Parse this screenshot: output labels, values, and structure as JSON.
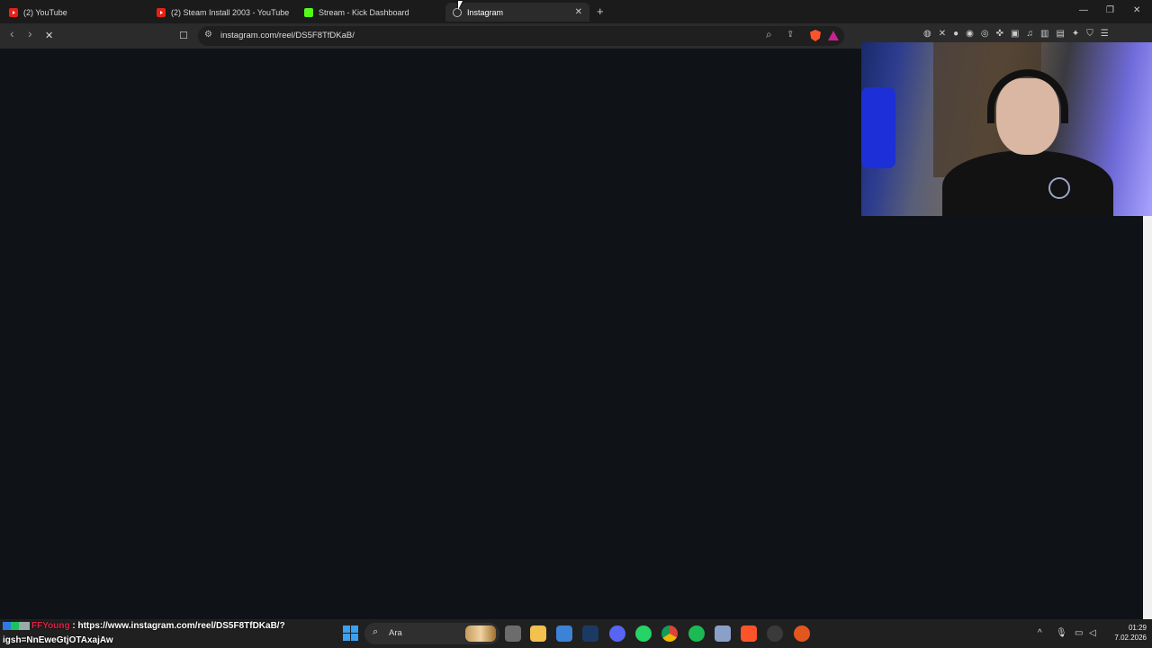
{
  "tabs": [
    {
      "label": "(2) YouTube",
      "icon": "youtube-icon"
    },
    {
      "label": "(2) Steam Install 2003 - YouTube",
      "icon": "youtube-icon"
    },
    {
      "label": "Stream - Kick Dashboard",
      "icon": "kick-icon"
    },
    {
      "label": "Instagram",
      "icon": "instagram-icon",
      "active": true
    }
  ],
  "tab_close": "✕",
  "new_tab": "+",
  "window_controls": {
    "minimize": "—",
    "maximize": "❐",
    "close": "✕"
  },
  "toolbar": {
    "back": "‹",
    "forward": "›",
    "stop": "✕",
    "bookmark": "☐",
    "url": "instagram.com/reel/DS5F8TfDKaB/",
    "site_info": "⚙",
    "zoom": "⌕",
    "share": "⇪"
  },
  "chat": {
    "username": "FFYoung",
    "separator": " : ",
    "message_line1": "https://www.instagram.com/reel/DS5F8TfDKaB/?",
    "message_line2": "igsh=NnEweGtjOTAxajAw"
  },
  "taskbar": {
    "search_label": "Ara",
    "apps": [
      "task-view-icon",
      "file-explorer-icon",
      "store-icon",
      "steam-icon",
      "discord-icon",
      "whatsapp-icon",
      "chrome-icon",
      "spotify-icon",
      "settings-app-icon",
      "brave-icon",
      "obs-icon",
      "app-icon"
    ],
    "tray_chevron": "^",
    "clock_time": "01:29",
    "clock_date": "7.02.2026"
  },
  "colors": {
    "page_bg": "#0f1317",
    "tabstrip_bg": "#1b1b1b",
    "toolbar_bg": "#2b2b2b",
    "taskbar_bg": "#202020",
    "chat_user": "#e0204a"
  }
}
